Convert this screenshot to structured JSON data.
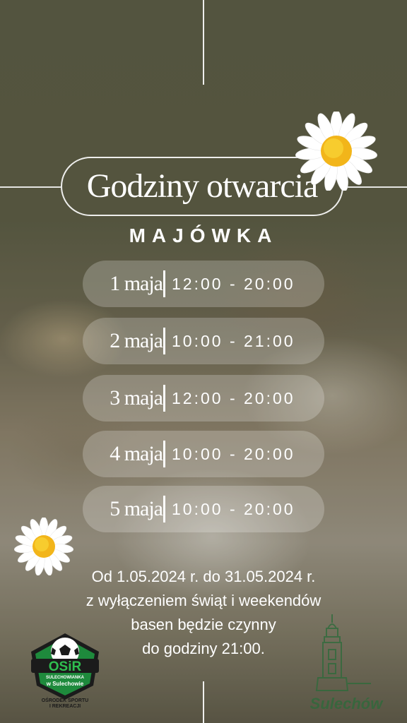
{
  "poster": {
    "title": "Godziny otwarcia",
    "subtitle": "MAJÓWKA",
    "schedule": [
      {
        "day": "1 maja",
        "hours": "12:00 - 20:00"
      },
      {
        "day": "2 maja",
        "hours": "10:00 - 21:00"
      },
      {
        "day": "3 maja",
        "hours": "12:00 - 20:00"
      },
      {
        "day": "4 maja",
        "hours": "10:00 - 20:00"
      },
      {
        "day": "5 maja",
        "hours": "10:00 - 20:00"
      }
    ],
    "note_lines": [
      "Od 1.05.2024 r. do 31.05.2024 r.",
      "z wyłączeniem świąt i weekendów",
      "basen będzie czynny",
      "do godziny 21:00."
    ]
  },
  "logo": {
    "name": "OSiR",
    "banner": "SULECHOWIANKA",
    "place": "w Sulechowie",
    "tagline_1": "OŚRODEK SPORTU",
    "tagline_2": "I REKREACJI"
  },
  "town_logo": {
    "name": "Sulechów"
  },
  "colors": {
    "text": "#ffffff",
    "daisy_center": "#f5c518",
    "logo_green": "#1e8a3c",
    "logo_dark": "#1b1b1b"
  },
  "icons": [
    "daisy-icon",
    "osir-logo",
    "sulechow-tower-logo"
  ]
}
